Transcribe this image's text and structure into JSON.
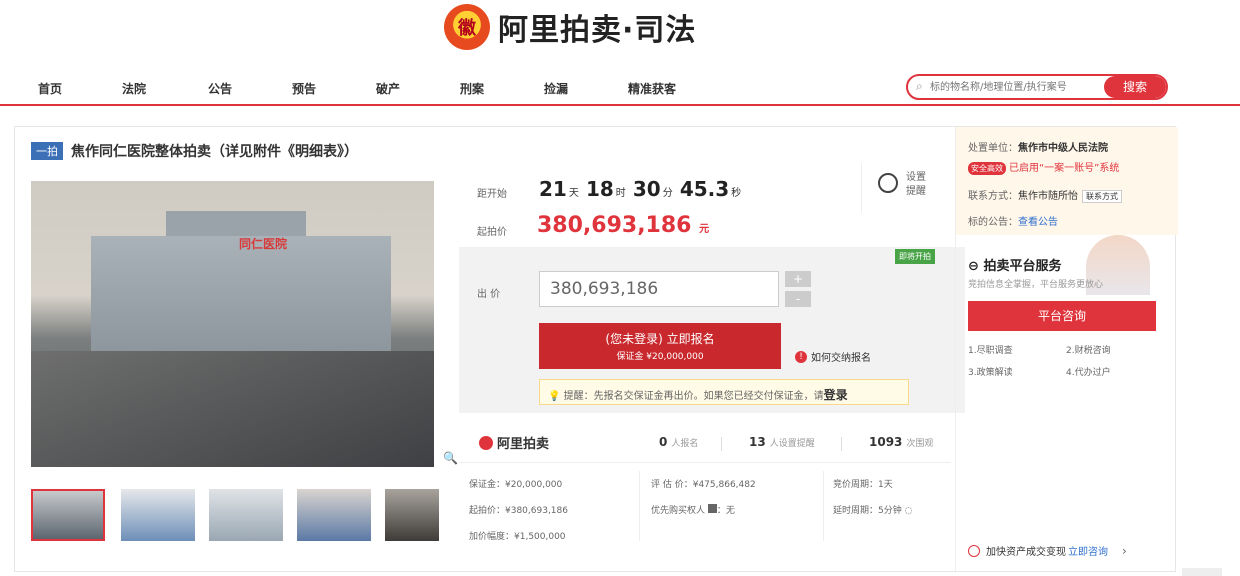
{
  "logo": {
    "emblem": "徽",
    "text": "阿里拍卖·司法"
  },
  "nav": [
    "首页",
    "法院",
    "公告",
    "预告",
    "破产",
    "刑案",
    "捡漏",
    "精准获客"
  ],
  "search": {
    "placeholder": "标的物名称/地理位置/执行案号",
    "button": "搜索"
  },
  "title": {
    "tag": "一拍",
    "text": "焦作同仁医院整体拍卖（详见附件《明细表》）"
  },
  "image": {
    "sign_text": "同仁医院"
  },
  "countdown": {
    "label": "距开始",
    "days": "21",
    "days_unit": "天",
    "hours": "18",
    "hours_unit": "时",
    "minutes": "30",
    "minutes_unit": "分",
    "seconds": "45.3",
    "seconds_unit": "秒"
  },
  "reminder": {
    "label": "设置提醒"
  },
  "start_price": {
    "label": "起拍价",
    "value": "380,693,186",
    "unit": "元"
  },
  "bid": {
    "badge": "即将开拍",
    "label": "出 价",
    "value": "380,693,186",
    "plus": "+",
    "minus": "-",
    "signup_line1": "(您未登录) 立即报名",
    "signup_line2": "保证金 ¥20,000,000",
    "how_to_pay": "如何交纳报名"
  },
  "tip": {
    "text": "提醒：先报名交保证金再出价。如果您已经交付保证金，请",
    "login": "登录"
  },
  "stats": {
    "brand": "阿里拍卖",
    "signups": "0",
    "signups_label": "人报名",
    "reminders": "13",
    "reminders_label": "人设置提醒",
    "views": "1093",
    "views_label": "次围观"
  },
  "details": {
    "deposit": "保证金：¥20,000,000",
    "start": "起拍价：¥380,693,186",
    "increment": "加价幅度：¥1,500,000",
    "appraisal": "评 估 价：¥475,866,482",
    "priority": "优先购买权人",
    "priority_value": "：无",
    "period": "竞价周期：1天",
    "delay": "延时周期：5分钟"
  },
  "side": {
    "disposal_label": "处置单位：",
    "disposal_value": "焦作市中级人民法院",
    "safe_badge": "安全高效",
    "safe_text": "已启用“一案一账号”系统",
    "contact_label": "联系方式：",
    "contact_value": "焦作市随所怡",
    "contact_btn": "联系方式",
    "notice_label": "标的公告：",
    "notice_link": "查看公告",
    "platform": "拍卖平台服务",
    "platform_sub": "竞拍信息全掌握，平台服务更放心",
    "consult": "平台咨询",
    "services": [
      "1.尽职调查",
      "2.财税咨询",
      "3.政策解读",
      "4.代办过户"
    ],
    "fast_text": "加快资产成交变现",
    "fast_link": "立即咨询",
    "arrow": "›"
  }
}
